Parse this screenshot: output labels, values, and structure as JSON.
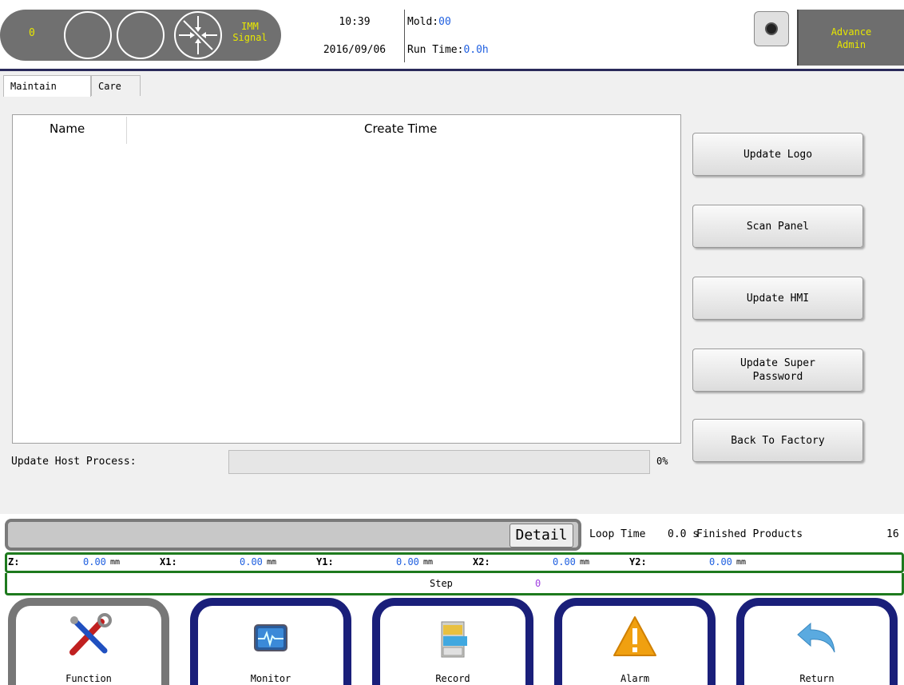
{
  "header": {
    "signal_count": "0",
    "imm_signal_line1": "IMM",
    "imm_signal_line2": "Signal",
    "time": "10:39",
    "date": "2016/09/06",
    "mold_label": "Mold:",
    "mold_value": "00",
    "runtime_label": "Run Time:",
    "runtime_value": "0.0h",
    "user_line1": "Advance",
    "user_line2": "Admin",
    "colors": {
      "indicator_text": "#e8e800",
      "value_blue": "#2060e0",
      "header_pill": "#707070"
    }
  },
  "tabs": [
    {
      "label": "Maintain",
      "active": true
    },
    {
      "label": "Care",
      "active": false
    }
  ],
  "table": {
    "columns": [
      "Name",
      "Create Time"
    ],
    "rows": []
  },
  "progress": {
    "label": "Update Host Process:",
    "value_pct": 0,
    "display": "0%"
  },
  "actions": [
    {
      "label": "Update Logo"
    },
    {
      "label": "Scan Panel"
    },
    {
      "label": "Update HMI"
    },
    {
      "label": "Update Super\nPassword"
    },
    {
      "label": "Back To Factory"
    }
  ],
  "status": {
    "detail_label": "Detail",
    "loop_label": "Loop Time",
    "loop_value": "0.0 s",
    "finished_label": "Finished Products",
    "finished_value": "16"
  },
  "axes": [
    {
      "name": "Z:",
      "value": "0.00",
      "unit": "mm"
    },
    {
      "name": "X1:",
      "value": "0.00",
      "unit": "mm"
    },
    {
      "name": "Y1:",
      "value": "0.00",
      "unit": "mm"
    },
    {
      "name": "X2:",
      "value": "0.00",
      "unit": "mm"
    },
    {
      "name": "Y2:",
      "value": "0.00",
      "unit": "mm"
    }
  ],
  "step": {
    "label": "Step",
    "value": "0"
  },
  "nav": [
    {
      "label": "Function",
      "icon": "tools-icon",
      "active": true
    },
    {
      "label": "Monitor",
      "icon": "monitor-icon",
      "active": false
    },
    {
      "label": "Record",
      "icon": "file-cabinet-icon",
      "active": false
    },
    {
      "label": "Alarm",
      "icon": "warning-icon",
      "active": false
    },
    {
      "label": "Return",
      "icon": "return-arrow-icon",
      "active": false
    }
  ],
  "nav_colors": {
    "active": "#777777",
    "inactive": "#1a1f7a"
  }
}
